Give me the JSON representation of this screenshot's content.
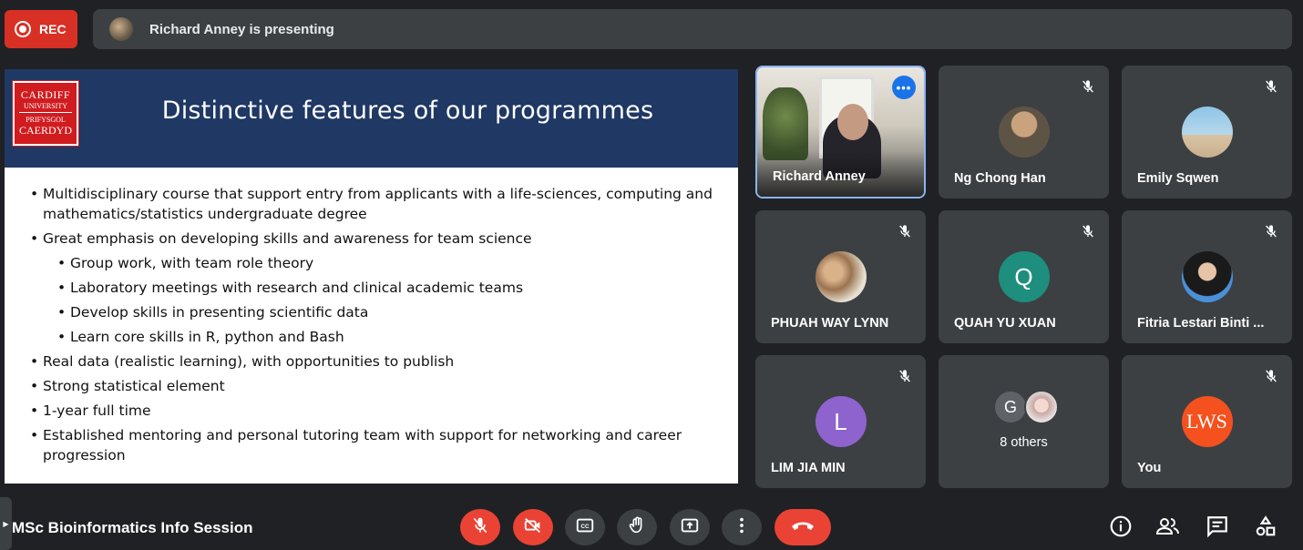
{
  "top": {
    "rec_label": "REC",
    "presenting_text": "Richard Anney is presenting"
  },
  "slide": {
    "logo": {
      "line1": "CARDIFF",
      "line2": "UNIVERSITY",
      "line3": "PRIFYSGOL",
      "line4": "CAERDYD"
    },
    "title": "Distinctive features of our programmes",
    "bullets": [
      "Multidisciplinary course that support entry from applicants with a life-sciences, computing and mathematics/statistics undergraduate degree",
      "Great emphasis on developing skills and awareness for team science",
      "Group work, with team role theory",
      "Laboratory meetings with research and clinical academic teams",
      "Develop skills in presenting scientific data",
      "Learn core skills in R, python and Bash",
      "Real data (realistic learning), with opportunities to publish",
      "Strong statistical element",
      "1-year full time",
      "Established mentoring and personal tutoring team with support for networking and career progression"
    ]
  },
  "participants": [
    {
      "name": "Richard Anney",
      "muted": false,
      "active_speaker": true
    },
    {
      "name": "Ng Chong Han",
      "muted": true
    },
    {
      "name": "Emily Sqwen",
      "muted": true
    },
    {
      "name": "PHUAH WAY LYNN",
      "muted": true
    },
    {
      "name": "QUAH YU XUAN",
      "muted": true,
      "initial": "Q",
      "color": "#1e8e7e"
    },
    {
      "name": "Fitria Lestari Binti ...",
      "muted": true
    },
    {
      "name": "LIM JIA MIN",
      "muted": true,
      "initial": "L",
      "color": "#8e63ce"
    },
    {
      "name": "8 others",
      "initial": "G",
      "color": "#5f6368"
    },
    {
      "name": "You",
      "muted": true,
      "initial": "LWS",
      "color": "#f4511e"
    }
  ],
  "bottom": {
    "meeting_title": "MSc Bioinformatics Info Session"
  },
  "colors": {
    "background": "#202124",
    "tile": "#3c4043",
    "danger": "#ea4335",
    "slide_header": "#1f3864",
    "speaker_border": "#8ab4f8"
  },
  "icons": [
    "record-icon",
    "mic-off-icon",
    "camera-off-icon",
    "captions-icon",
    "raise-hand-icon",
    "present-screen-icon",
    "more-options-icon",
    "end-call-icon",
    "info-icon",
    "people-icon",
    "chat-icon",
    "activities-icon"
  ]
}
